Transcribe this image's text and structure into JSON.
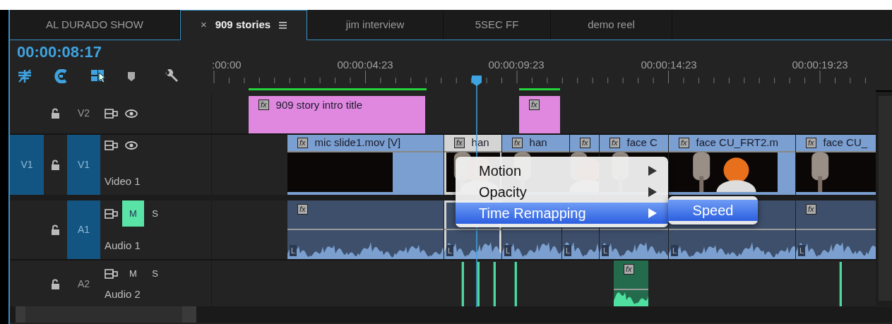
{
  "tabs": [
    {
      "label": "AL DURADO SHOW",
      "selected": false
    },
    {
      "label": "909 stories",
      "selected": true,
      "close": "×"
    },
    {
      "label": "jim interview",
      "selected": false
    },
    {
      "label": "5SEC FF",
      "selected": false
    },
    {
      "label": "demo reel",
      "selected": false
    }
  ],
  "timecode": "00:00:08:17",
  "ruler": {
    "labels": [
      ":00:00",
      "00:00:04:23",
      "00:00:09:23",
      "00:00:14:23",
      "00:00:19:23"
    ]
  },
  "tracks": [
    {
      "kind": "graphics",
      "label": "V2",
      "targeted": false,
      "clips": [
        {
          "title": "909 story intro title",
          "badge": "fx",
          "selected": false
        },
        {
          "badge": "fx",
          "selected": false
        }
      ]
    },
    {
      "kind": "video",
      "source_patch": "V1",
      "label": "V1",
      "targeted": true,
      "name": "Video 1",
      "clips": [
        {
          "title": "mic slide1.mov [V]",
          "badge": "fx",
          "selected": false
        },
        {
          "title": "han",
          "badge": "fx",
          "selected": true
        },
        {
          "title": "han",
          "badge": "fx",
          "selected": false
        },
        {
          "badge": "fx",
          "selected": false
        },
        {
          "title": "face C",
          "badge": "fx",
          "selected": false
        },
        {
          "title": "face CU_FRT2.m",
          "badge": "fx",
          "selected": false
        },
        {
          "title": "face CU_",
          "badge": "fx",
          "selected": false
        }
      ]
    },
    {
      "kind": "audio",
      "label": "A1",
      "targeted": true,
      "name": "Audio 1",
      "mute": "M",
      "solo": "S",
      "muted": true,
      "clips": [
        {
          "badge": "fx",
          "channel": "L",
          "selected": false
        },
        {
          "channel": "L",
          "selected": true
        },
        {
          "channel": "L",
          "selected": false
        },
        {
          "channel": "L",
          "selected": false
        },
        {
          "channel": "L",
          "selected": false
        },
        {
          "channel": "L",
          "selected": false
        },
        {
          "badge": "fx",
          "channel": "L",
          "selected": false
        }
      ]
    },
    {
      "kind": "audio",
      "label": "A2",
      "targeted": false,
      "name": "Audio 2",
      "mute": "M",
      "solo": "S",
      "muted": false,
      "clips": [
        {
          "kind": "sliver"
        },
        {
          "kind": "sliver"
        },
        {
          "kind": "sliver"
        },
        {
          "kind": "sliver"
        },
        {
          "kind": "clip",
          "badge": "fx",
          "selected": false
        },
        {
          "kind": "sliver"
        }
      ]
    }
  ],
  "context_menu": {
    "items": [
      {
        "label": "Motion",
        "selected": false
      },
      {
        "label": "Opacity",
        "selected": false
      },
      {
        "label": "Time Remapping",
        "selected": true
      }
    ],
    "submenu": {
      "items": [
        {
          "label": "Speed",
          "selected": true
        }
      ]
    }
  }
}
